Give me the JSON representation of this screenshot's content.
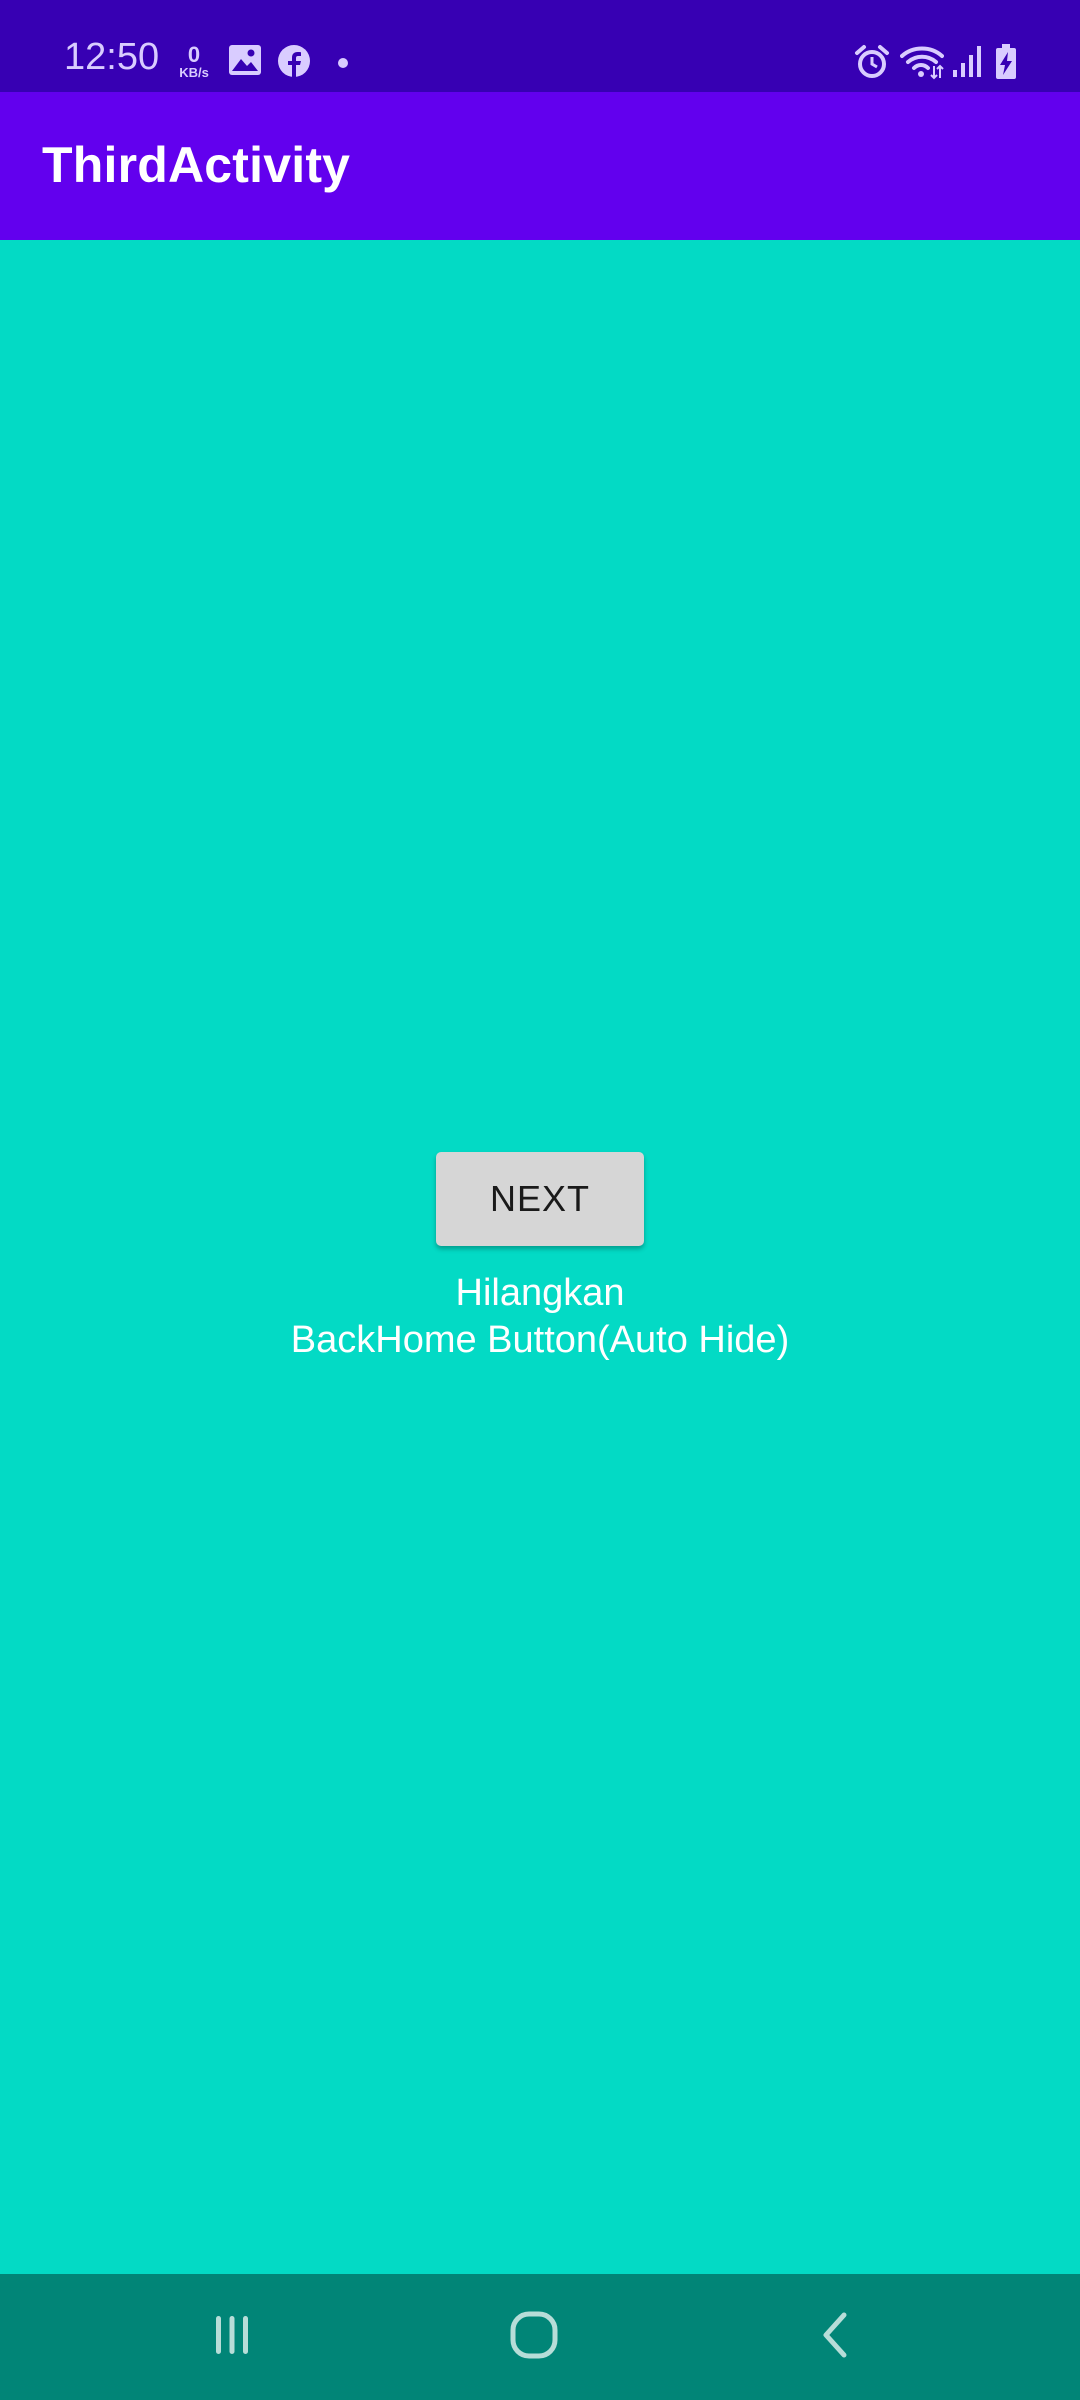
{
  "status_bar": {
    "time": "12:50",
    "net_speed_value": "0",
    "net_speed_unit": "KB/s",
    "left_icons": [
      "gallery-icon",
      "facebook-icon",
      "dot-icon"
    ],
    "right_icons": [
      "alarm-icon",
      "wifi-icon",
      "signal-icon",
      "battery-charging-icon"
    ]
  },
  "app_bar": {
    "title": "ThirdActivity"
  },
  "content": {
    "next_button_label": "NEXT",
    "message_line1": "Hilangkan",
    "message_line2": "BackHome Button(Auto Hide)"
  },
  "nav_bar": {
    "icons": [
      "recent-apps-icon",
      "home-icon",
      "back-icon"
    ]
  },
  "colors": {
    "status_bar": "#3700b3",
    "app_bar": "#6200ee",
    "background": "#03dac5",
    "nav_bar": "#018577",
    "button": "#d6d6d6"
  }
}
